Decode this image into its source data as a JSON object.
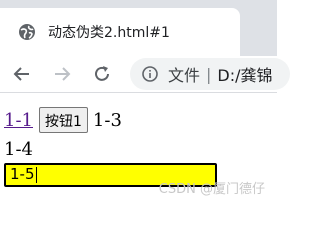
{
  "tab": {
    "title": "动态伪类2.html#1",
    "favicon": "globe-icon"
  },
  "toolbar": {
    "back_icon": "arrow-left-icon",
    "forward_icon": "arrow-right-icon",
    "reload_icon": "reload-icon",
    "info_icon": "info-icon",
    "chip_label": "文件",
    "chip_separator": "|",
    "url": "D:/龚锦"
  },
  "page": {
    "link_label": "1-1",
    "button_label": "按钮1",
    "text_1_3": "1-3",
    "text_1_4": "1-4",
    "input_value": "1-5",
    "watermark": "CSDN @厦门德仔"
  },
  "colors": {
    "visited_link": "#551a8b",
    "input_bg": "#ffff00",
    "tabstrip_bg": "#dee1e6"
  }
}
